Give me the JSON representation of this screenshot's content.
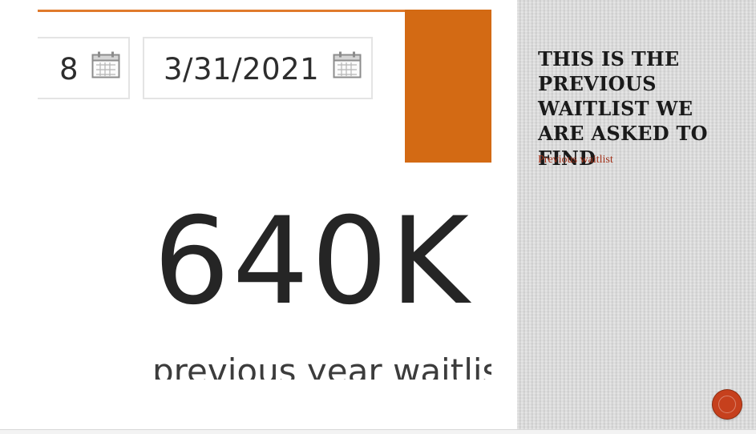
{
  "report_visual": {
    "start_date_fragment": "8",
    "end_date": "3/31/2021",
    "calendar_icon": "calendar-icon",
    "kpi_value": "640K",
    "kpi_caption": "previous year waitlis",
    "accent_color": "#d36a14"
  },
  "notes_panel": {
    "title": "This is the previous waitlist we are asked to find",
    "link_text": "Previous waitlist",
    "link_color": "#a4331b",
    "button_icon": "nav-circle-icon",
    "button_color": "#c6401d"
  }
}
